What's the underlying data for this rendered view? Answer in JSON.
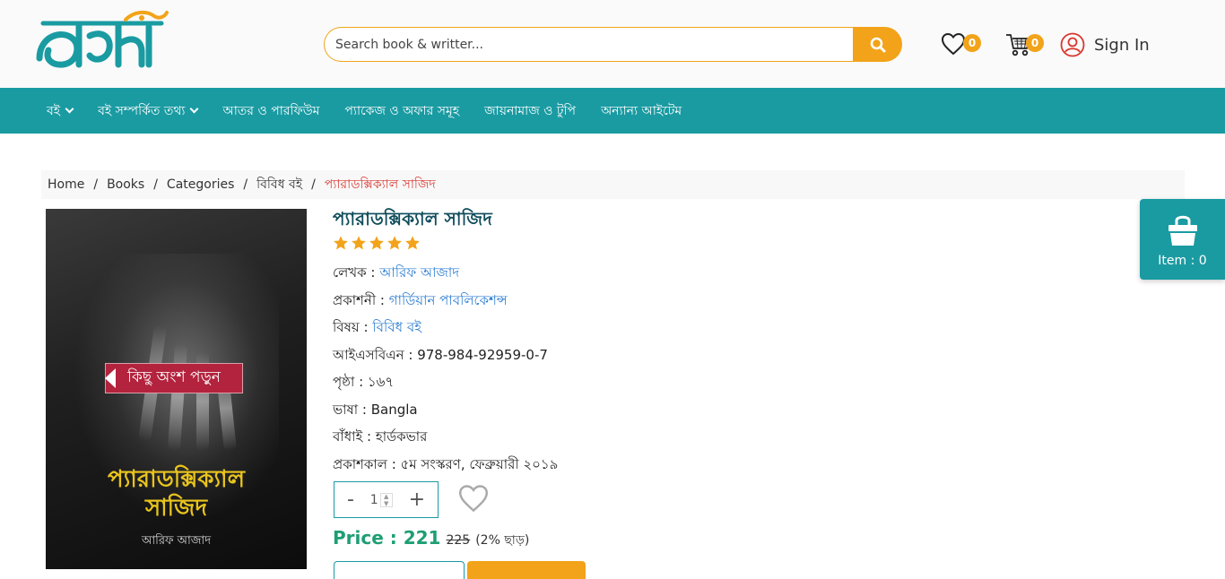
{
  "header": {
    "logo_text": "আহসান",
    "search": {
      "placeholder": "Search book & writter..."
    },
    "wishlist_count": "0",
    "cart_count": "0",
    "signin_label": "Sign In"
  },
  "nav": {
    "items": [
      {
        "label": "বই",
        "has_dropdown": true
      },
      {
        "label": "বই সম্পর্কিত তথ্য",
        "has_dropdown": true
      },
      {
        "label": "আতর ও পারফিউম",
        "has_dropdown": false
      },
      {
        "label": "প্যাকেজ ও অফার সমূহ",
        "has_dropdown": false
      },
      {
        "label": "জায়নামাজ ও টুপি",
        "has_dropdown": false
      },
      {
        "label": "অন্যান্য আইটেম",
        "has_dropdown": false
      }
    ]
  },
  "breadcrumb": {
    "items": [
      "Home",
      "Books",
      "Categories",
      "বিবিধ বই"
    ],
    "separator": "/",
    "current": "প্যারাডক্সিক্যাল সাজিদ"
  },
  "cover": {
    "read_label": "কিছু অংশ পড়ুন",
    "title_line1": "প্যারাডক্সিক্যাল",
    "title_line2": "সাজিদ",
    "author": "আরিফ আজাদ"
  },
  "book": {
    "title": "প্যারাডক্সিক্যাল সাজিদ",
    "rating": 5,
    "author_label": "লেখক :",
    "author": "আরিফ আজাদ",
    "publisher_label": "প্রকাশনী :",
    "publisher": "গার্ডিয়ান পাবলিকেশন্স",
    "subject_label": "বিষয় :",
    "subject": "বিবিধ বই",
    "isbn": "আইএসবিএন : 978-984-92959-0-7",
    "pages": "পৃষ্ঠা : ১৬৭",
    "language": "ভাষা : Bangla",
    "binding": "বাঁধাই : হার্ডকভার",
    "published": "প্রকাশকাল : ৫ম সংস্করণ, ফেব্রুয়ারী ২০১৯"
  },
  "quantity": {
    "minus": "-",
    "value": "1",
    "plus": "+"
  },
  "price": {
    "label": "Price : 221",
    "old": "225",
    "discount": "(2% ছাড়)"
  },
  "float_cart": {
    "label": "Item : 0"
  },
  "colors": {
    "teal": "#1a9ba2",
    "orange": "#f2a319",
    "price_green": "#1e9e74",
    "link_blue": "#2a7bd1",
    "breadcrumb_current": "#d9372f"
  },
  "icons": [
    "search-icon",
    "heart-icon",
    "cart-icon",
    "user-icon",
    "star-icon",
    "shopping-bag-icon"
  ]
}
